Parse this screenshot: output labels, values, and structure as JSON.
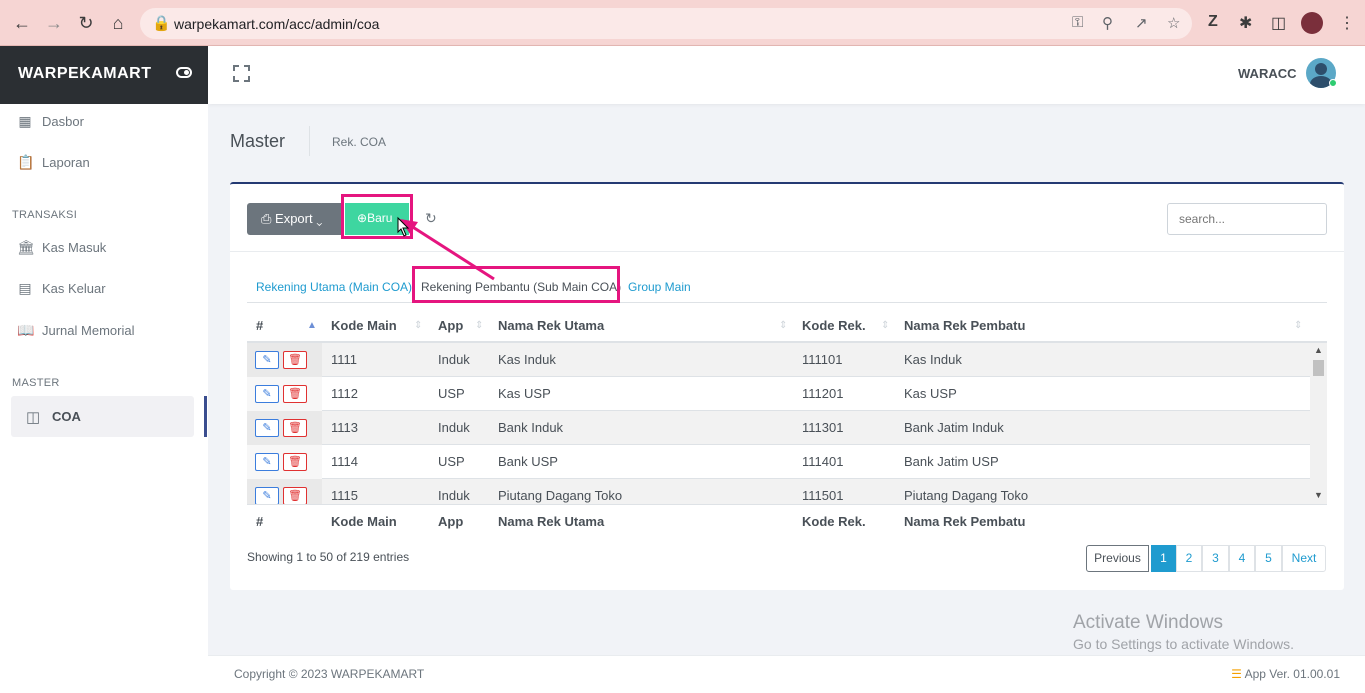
{
  "browser": {
    "url": "warpekamart.com/acc/admin/coa",
    "icons": [
      "back-icon",
      "forward-icon",
      "reload-icon",
      "home-icon",
      "lock-icon",
      "key-icon",
      "zoom-icon",
      "share-icon",
      "star-icon",
      "zotero-icon",
      "extensions-icon",
      "sidepanel-icon",
      "profile-avatar",
      "menu-icon"
    ]
  },
  "sidebar": {
    "brand": "WARPEKAMART",
    "items_top": [
      {
        "label": "Dasbor",
        "icon": "grid-icon"
      },
      {
        "label": "Laporan",
        "icon": "clipboard-icon"
      }
    ],
    "section_transaksi": "TRANSAKSI",
    "items_transaksi": [
      {
        "label": "Kas Masuk",
        "icon": "bank-icon"
      },
      {
        "label": "Kas Keluar",
        "icon": "cash-icon"
      },
      {
        "label": "Jurnal Memorial",
        "icon": "book-icon"
      }
    ],
    "section_master": "MASTER",
    "active_item": {
      "label": "COA",
      "icon": "notebook-icon"
    }
  },
  "header": {
    "user": "WARACC"
  },
  "page": {
    "title": "Master",
    "breadcrumb": "Rek. COA"
  },
  "toolbar": {
    "export_label": "Export",
    "baru_label": "Baru",
    "search_placeholder": "search..."
  },
  "tabs": [
    {
      "label": "Rekening Utama (Main COA)"
    },
    {
      "label": "Rekening Pembantu (Sub Main COA)"
    },
    {
      "label": "Group Main"
    }
  ],
  "table": {
    "columns": [
      "#",
      "Kode Main",
      "App",
      "Nama Rek Utama",
      "Kode Rek.",
      "Nama Rek Pembatu"
    ],
    "rows": [
      {
        "kode_main": "1111",
        "app": "Induk",
        "nama_utama": "Kas Induk",
        "kode_rek": "111101",
        "nama_pembatu": "Kas Induk"
      },
      {
        "kode_main": "1112",
        "app": "USP",
        "nama_utama": "Kas USP",
        "kode_rek": "111201",
        "nama_pembatu": "Kas USP"
      },
      {
        "kode_main": "1113",
        "app": "Induk",
        "nama_utama": "Bank Induk",
        "kode_rek": "111301",
        "nama_pembatu": "Bank Jatim Induk"
      },
      {
        "kode_main": "1114",
        "app": "USP",
        "nama_utama": "Bank USP",
        "kode_rek": "111401",
        "nama_pembatu": "Bank Jatim USP"
      },
      {
        "kode_main": "1115",
        "app": "Induk",
        "nama_utama": "Piutang Dagang Toko",
        "kode_rek": "111501",
        "nama_pembatu": "Piutang Dagang Toko"
      }
    ],
    "info": "Showing 1 to 50 of 219 entries"
  },
  "pagination": {
    "previous": "Previous",
    "pages": [
      "1",
      "2",
      "3",
      "4",
      "5"
    ],
    "current": "1",
    "next": "Next"
  },
  "footer": {
    "copyright": "Copyright © 2023 WARPEKAMART",
    "version": "App Ver. 01.00.01"
  },
  "watermark": {
    "line1": "Activate Windows",
    "line2": "Go to Settings to activate Windows."
  },
  "colors": {
    "brand_dark": "#2b2f33",
    "accent_blue": "#1f9bcf",
    "baru_green": "#3ed6a0",
    "annotation_pink": "#e5157f",
    "card_top": "#243a73"
  }
}
